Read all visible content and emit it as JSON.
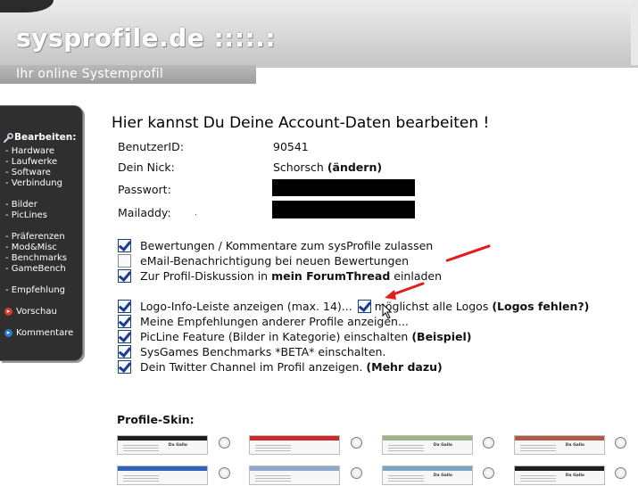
{
  "header": {
    "logo": "sysprofile.de ::::.:",
    "subtitle": "Ihr online Systemprofil"
  },
  "sidebar": {
    "heading": "Bearbeiten:",
    "items": [
      "- Hardware",
      "- Laufwerke",
      "- Software",
      "- Verbindung",
      "- Bilder",
      "- PicLines",
      "- Präferenzen",
      "- Mod&Misc",
      "- Benchmarks",
      "- GameBench",
      "- Empfehlung"
    ],
    "preview": "Vorschau",
    "comments": "Kommentare",
    "icons": [
      "wrench-icon",
      "red-arrow-icon",
      "blue-arrow-icon"
    ]
  },
  "main": {
    "title": "Hier kannst Du Deine Account-Daten bearbeiten !",
    "fields": [
      {
        "label": "BenutzerID:",
        "value": "90541"
      },
      {
        "label": "Dein Nick:",
        "value": "Schorsch",
        "link": "(ändern)"
      },
      {
        "label": "Passwort:",
        "value": ""
      },
      {
        "label": "Mailaddy:",
        "value": ""
      }
    ],
    "options_group1": [
      {
        "checked": true,
        "text": "Bewertungen / Kommentare zum sysProfile zulassen"
      },
      {
        "checked": false,
        "text": "eMail-Benachrichtigung bei neuen Bewertungen"
      },
      {
        "checked": true,
        "text": "Zur Profil-Diskussion in ",
        "link": "mein ForumThread",
        "suffix": " einladen"
      }
    ],
    "options_group2": [
      {
        "checked": true,
        "text": "Logo-Info-Leiste anzeigen (max. 14)...",
        "sub_checked": true,
        "sub_text": "möglichst alle Logos",
        "link": "(Logos fehlen?)"
      },
      {
        "checked": true,
        "text": "Meine Empfehlungen anderer Profile anzeigen..."
      },
      {
        "checked": true,
        "text": "PicLine Feature (Bilder in Kategorie) einschalten ",
        "link": "(Beispiel)"
      },
      {
        "checked": true,
        "text": "SysGames Benchmarks *BETA* einschalten."
      },
      {
        "checked": true,
        "text": "Dein Twitter Channel im Profil anzeigen. ",
        "link": "(Mehr dazu)"
      }
    ],
    "skin_title": "Profile-Skin:",
    "skins": [
      {
        "label": "Da Gallo",
        "band": "#1f1f1f"
      },
      {
        "label": "",
        "band": "#c72a2a"
      },
      {
        "label": "Da Gallo",
        "band": "#9fb38a"
      },
      {
        "label": "Da Gallo",
        "band": "#b05a4a"
      },
      {
        "label": "",
        "band": "#2f62b8"
      },
      {
        "label": "",
        "band": "#8fa7c9"
      },
      {
        "label": "Da Gallo",
        "band": "#7aa6c2"
      },
      {
        "label": "Da Gallo",
        "band": "#1d1d1d"
      }
    ]
  },
  "colors": {
    "sidebar_bg": "#2f2f2f",
    "checkbox_tick": "#1b3b8f",
    "annotation": "#e21b1b"
  }
}
